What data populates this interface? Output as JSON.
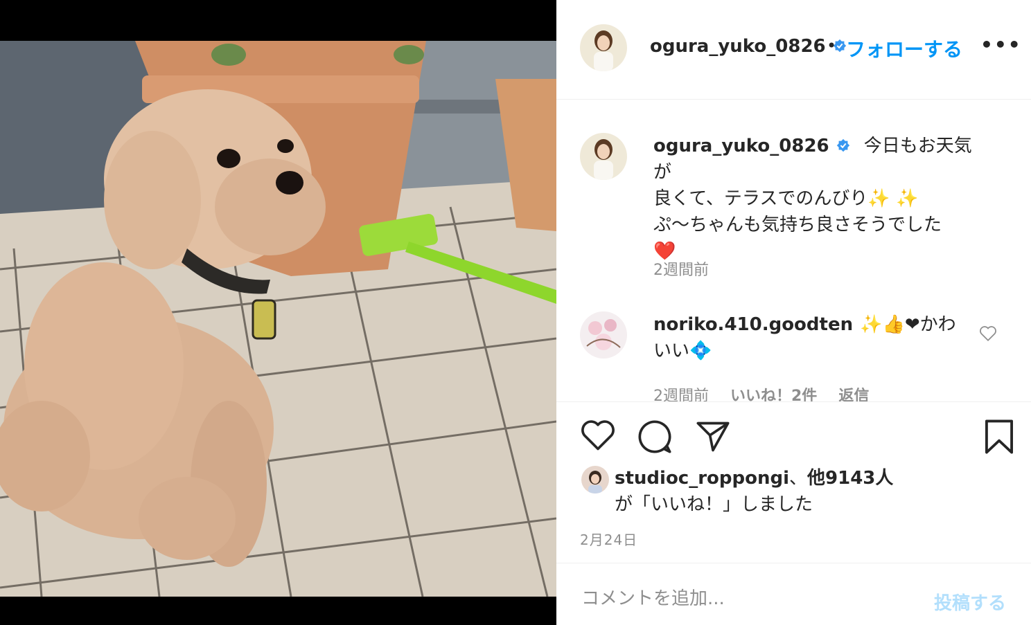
{
  "post": {
    "username": "ogura_yuko_0826",
    "follow_label": "フォローする",
    "more_label": "•••",
    "dot": "•"
  },
  "caption": {
    "username": "ogura_yuko_0826",
    "text_line1": "今日もお天気が",
    "text_line2": "良くて、テラスでのんびり✨ ✨",
    "text_line3": "ぷ〜ちゃんも気持ち良さそうでした",
    "text_line4": "❤️",
    "time": "2週間前"
  },
  "comment": {
    "username": "noriko.410.goodten",
    "text_line1": "✨👍❤かわ",
    "text_line2": "いい💠",
    "time": "2週間前",
    "likes": "いいね！2件",
    "reply": "返信"
  },
  "likes": {
    "user": "studioc_roppongi",
    "sep": "、",
    "others": "他9143人",
    "suffix": "が「いいね！」しました"
  },
  "date": "2月24日",
  "comment_box": {
    "placeholder": "コメントを追加...",
    "post_label": "投稿する"
  },
  "colors": {
    "link": "#0095f6",
    "post_disabled": "#b2dffc",
    "verified": "#3897f0"
  }
}
